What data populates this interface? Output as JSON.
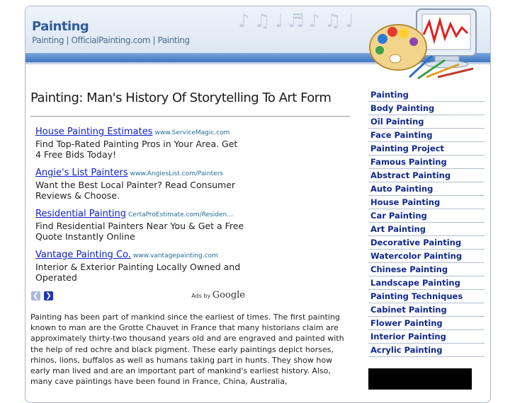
{
  "site": {
    "title": "Painting",
    "tagline": "Painting | OfficialPainting.com | Painting"
  },
  "main": {
    "heading": "Painting: Man's History Of Storytelling To Art Form",
    "ads": [
      {
        "title": "House Painting Estimates",
        "url": "www.ServiceMagic.com",
        "desc": "Find Top-Rated Painting Pros in Your Area. Get 4 Free Bids Today!"
      },
      {
        "title": "Angie's List Painters",
        "url": "www.AngiesList.com/Painters",
        "desc": "Want the Best Local Painter? Read Consumer Reviews & Choose."
      },
      {
        "title": "Residential Painting",
        "url": "CertaProEstimate.com/Residen...",
        "desc": "Find Residential Painters Near You & Get a Free Quote Instantly Online"
      },
      {
        "title": "Vantage Painting Co.",
        "url": "www.vantagepainting.com",
        "desc": "Interior & Exterior Painting Locally Owned and Operated"
      }
    ],
    "ads_by_prefix": "Ads by",
    "ads_by_brand": "Google",
    "article": "Painting has been part of mankind since the earliest of times. The first painting known to man are the Grotte Chauvet in France that many historians claim are approximately thirty-two thousand years old and are engraved and painted with the help of red ochre and black pigment. These early paintings depict horses, rhinos, lions, buffalos as well as humans taking part in hunts. They show how early man lived and are an important part of mankind's earliest history. Also, many cave paintings have been found in France, China, Australia,"
  },
  "sidebar": {
    "items": [
      "Painting",
      "Body Painting",
      "Oil Painting",
      "Face Painting",
      "Painting Project",
      "Famous Painting",
      "Abstract Painting",
      "Auto Painting",
      "House Painting",
      "Car Painting",
      "Art Painting",
      "Decorative Painting",
      "Watercolor Painting",
      "Chinese Painting",
      "Landscape Painting",
      "Painting Techniques",
      "Cabinet Painting",
      "Flower Painting",
      "Interior Painting",
      "Acrylic Painting"
    ]
  },
  "icons": {
    "header_art": "palette-monitor-icon",
    "prev": "chevron-left-icon",
    "next": "chevron-right-icon"
  },
  "colors": {
    "link": "#0d1fc9",
    "sidebar_link": "#10288c",
    "title": "#2e5c9a",
    "bar": "#3d74c2"
  }
}
